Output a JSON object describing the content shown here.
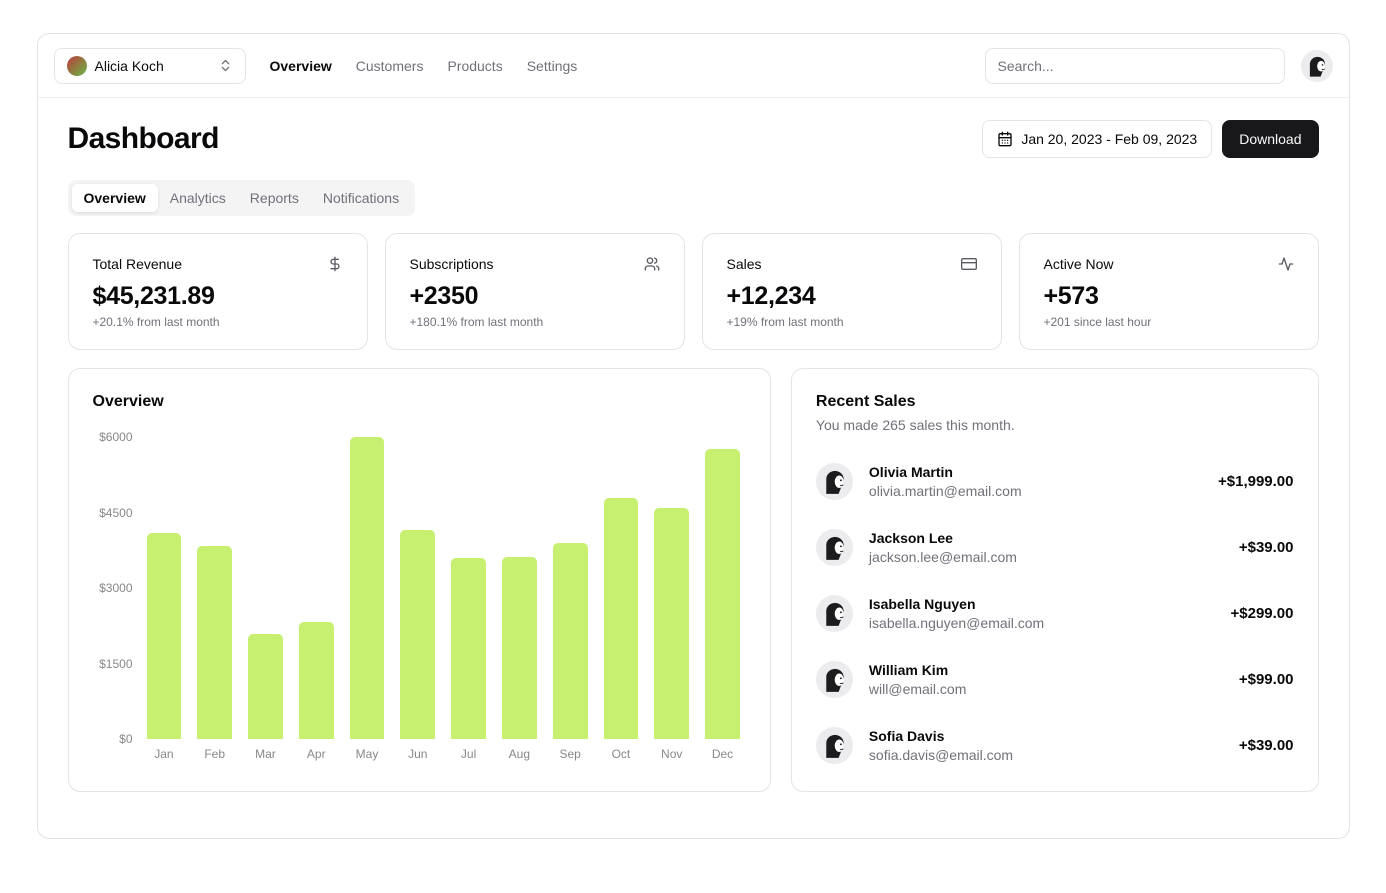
{
  "header": {
    "team_switcher": {
      "name": "Alicia Koch"
    },
    "nav": [
      {
        "label": "Overview",
        "active": true
      },
      {
        "label": "Customers",
        "active": false
      },
      {
        "label": "Products",
        "active": false
      },
      {
        "label": "Settings",
        "active": false
      }
    ],
    "search": {
      "placeholder": "Search..."
    }
  },
  "page": {
    "title": "Dashboard",
    "date_range": "Jan 20, 2023 - Feb 09, 2023",
    "download_label": "Download"
  },
  "tabs": [
    {
      "label": "Overview",
      "active": true
    },
    {
      "label": "Analytics",
      "active": false
    },
    {
      "label": "Reports",
      "active": false
    },
    {
      "label": "Notifications",
      "active": false
    }
  ],
  "stats": [
    {
      "label": "Total Revenue",
      "icon": "dollar-sign-icon",
      "value": "$45,231.89",
      "change": "+20.1% from last month"
    },
    {
      "label": "Subscriptions",
      "icon": "users-icon",
      "value": "+2350",
      "change": "+180.1% from last month"
    },
    {
      "label": "Sales",
      "icon": "credit-card-icon",
      "value": "+12,234",
      "change": "+19% from last month"
    },
    {
      "label": "Active Now",
      "icon": "activity-icon",
      "value": "+573",
      "change": "+201 since last hour"
    }
  ],
  "chart_data": {
    "type": "bar",
    "title": "Overview",
    "categories": [
      "Jan",
      "Feb",
      "Mar",
      "Apr",
      "May",
      "Jun",
      "Jul",
      "Aug",
      "Sep",
      "Oct",
      "Nov",
      "Dec"
    ],
    "values": [
      4100,
      3840,
      2080,
      2330,
      6000,
      4150,
      3590,
      3620,
      3890,
      4790,
      4590,
      5770
    ],
    "xlabel": "",
    "ylabel": "",
    "ylim": [
      0,
      6000
    ],
    "yticks": [
      {
        "label": "$6000",
        "value": 6000
      },
      {
        "label": "$4500",
        "value": 4500
      },
      {
        "label": "$3000",
        "value": 3000
      },
      {
        "label": "$1500",
        "value": 1500
      },
      {
        "label": "$0",
        "value": 0
      }
    ],
    "grid": false,
    "legend": "none",
    "bar_color": "#c7f070"
  },
  "recent_sales": {
    "title": "Recent Sales",
    "subtitle": "You made 265 sales this month.",
    "items": [
      {
        "name": "Olivia Martin",
        "email": "olivia.martin@email.com",
        "amount": "+$1,999.00"
      },
      {
        "name": "Jackson Lee",
        "email": "jackson.lee@email.com",
        "amount": "+$39.00"
      },
      {
        "name": "Isabella Nguyen",
        "email": "isabella.nguyen@email.com",
        "amount": "+$299.00"
      },
      {
        "name": "William Kim",
        "email": "will@email.com",
        "amount": "+$99.00"
      },
      {
        "name": "Sofia Davis",
        "email": "sofia.davis@email.com",
        "amount": "+$39.00"
      }
    ]
  },
  "colors": {
    "accent_bar": "#c7f070",
    "text_primary": "#09090b",
    "text_muted": "#71717a",
    "border": "#e4e4e7",
    "button_dark": "#18181b"
  }
}
